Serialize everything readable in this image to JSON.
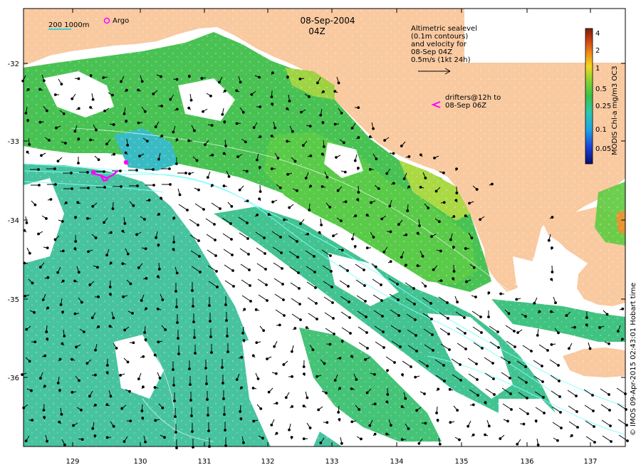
{
  "title": {
    "date": "08-Sep-2004",
    "time": "04Z"
  },
  "scale_label": "200  1000m",
  "argo_label": "Argo",
  "sealevel_note": "Altimetric sealevel\n(0.1m contours)\nand velocity for\n08-Sep 04Z\n0.5m/s (1kt 24h)",
  "drifters_note": "drifters@12h to\n08-Sep 06Z",
  "colorbar": {
    "title": "MODIS Chl-a mg/m3 OC3",
    "ticks": [
      "4",
      "2",
      "1",
      "0.5",
      "0.25",
      "0.1",
      "0.05"
    ]
  },
  "credit": "© IMOS 09-Apr-2015 02:43:01 Hobart time",
  "x_ticks": [
    "129",
    "130",
    "131",
    "132",
    "133",
    "134",
    "135",
    "136",
    "137"
  ],
  "y_ticks": [
    "-32",
    "-33",
    "-34",
    "-35",
    "-36"
  ],
  "colors": {
    "land": "#f9c9a0",
    "ocean_green": "#3fbf4a",
    "teal": "#3ec09a",
    "argo": "#ff00ff",
    "contour": "#7fffff"
  }
}
